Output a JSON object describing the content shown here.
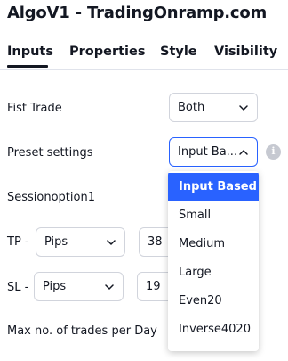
{
  "window": {
    "title": "AlgoV1 - TradingOnramp.com"
  },
  "tabs": [
    {
      "label": "Inputs",
      "active": true
    },
    {
      "label": "Properties",
      "active": false
    },
    {
      "label": "Style",
      "active": false
    },
    {
      "label": "Visibility",
      "active": false
    }
  ],
  "inputs": {
    "fist_trade": {
      "label": "Fist Trade",
      "value": "Both"
    },
    "preset_settings": {
      "label": "Preset settings",
      "value": "Input Ba..."
    },
    "sessionoption": {
      "label": "Sessionoption1"
    },
    "tp": {
      "label": "TP -",
      "unit": "Pips",
      "value": "38"
    },
    "sl": {
      "label": "SL -",
      "unit": "Pips",
      "value": "19"
    },
    "max_trades": {
      "label": "Max no. of trades per Day"
    }
  },
  "preset_dropdown": {
    "options": [
      "Input Based",
      "Small",
      "Medium",
      "Large",
      "Even20",
      "Inverse4020"
    ],
    "selected": "Input Based"
  },
  "icons": {
    "chevron": "chevron-down-icon",
    "chevron_open": "chevron-up-icon",
    "info": "info-icon"
  },
  "colors": {
    "accent": "#2962ff",
    "text": "#131722",
    "border": "#d1d4dc"
  }
}
